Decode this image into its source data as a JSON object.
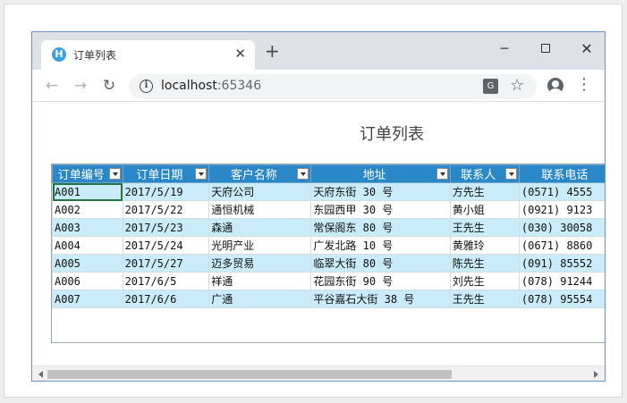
{
  "browser": {
    "tab_title": "订单列表",
    "tab_icon_letter": "H",
    "tab_close": "✕",
    "new_tab": "+",
    "minimize": "─",
    "close": "✕",
    "url_host": "localhost",
    "url_port": ":65346"
  },
  "page": {
    "title": "订单列表"
  },
  "grid": {
    "columns": [
      "订单编号",
      "订单日期",
      "客户名称",
      "地址",
      "联系人",
      "联系电话"
    ],
    "rows": [
      [
        "A001",
        "2017/5/19",
        "天府公司",
        "天府东街 30 号",
        "方先生",
        "(0571) 4555"
      ],
      [
        "A002",
        "2017/5/22",
        "通恒机械",
        "东园西甲 30 号",
        "黄小姐",
        "(0921) 9123"
      ],
      [
        "A003",
        "2017/5/23",
        "森通",
        "常保阁东 80 号",
        "王先生",
        "(030) 30058"
      ],
      [
        "A004",
        "2017/5/24",
        "光明产业",
        "广发北路 10 号",
        "黄雅玲",
        "(0671) 8860"
      ],
      [
        "A005",
        "2017/5/27",
        "迈多贸易",
        "临翠大街 80 号",
        "陈先生",
        "(091) 85552"
      ],
      [
        "A006",
        "2017/6/5",
        "祥通",
        "花园东街 90 号",
        "刘先生",
        "(078) 91244"
      ],
      [
        "A007",
        "2017/6/6",
        "广通",
        "平谷嘉石大街 38 号",
        "王先生",
        "(078) 95554"
      ]
    ]
  },
  "colors": {
    "header_bg": "#2a88c8",
    "alt_row_bg": "#c9ebfa",
    "selection_border": "#227447"
  }
}
